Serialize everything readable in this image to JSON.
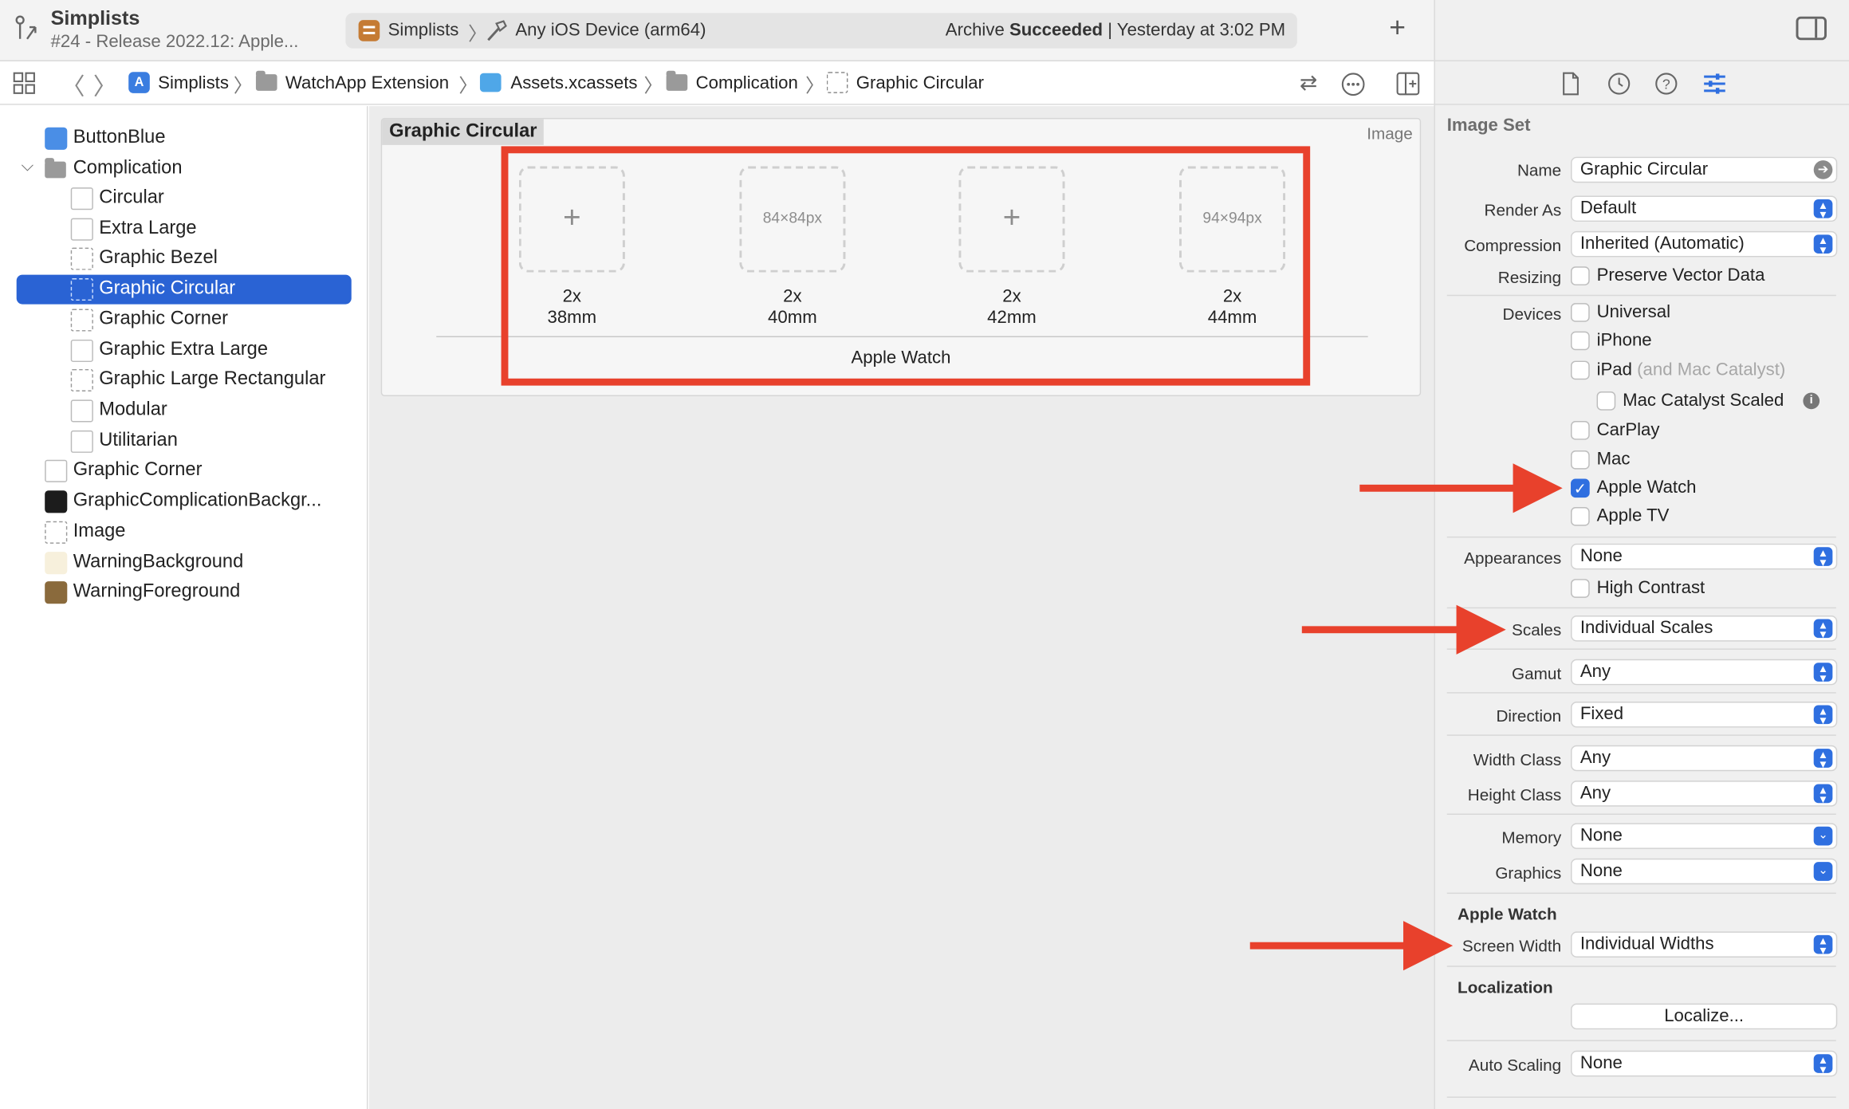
{
  "toolbar": {
    "project_title": "Simplists",
    "project_subtitle": "#24 - Release 2022.12: Apple...",
    "scheme_name": "Simplists",
    "device": "Any iOS Device (arm64)",
    "status_prefix": "Archive ",
    "status_bold": "Succeeded",
    "status_suffix": " | Yesterday at 3:02 PM"
  },
  "breadcrumbs": [
    "Simplists",
    "WatchApp Extension",
    "Assets.xcassets",
    "Complication",
    "Graphic Circular"
  ],
  "navigator": {
    "items": [
      {
        "label": "ButtonBlue",
        "swatch": "#4a8ee6"
      },
      {
        "label": "Complication"
      },
      {
        "label": "Circular"
      },
      {
        "label": "Extra Large"
      },
      {
        "label": "Graphic Bezel"
      },
      {
        "label": "Graphic Circular"
      },
      {
        "label": "Graphic Corner"
      },
      {
        "label": "Graphic Extra Large"
      },
      {
        "label": "Graphic Large Rectangular"
      },
      {
        "label": "Modular"
      },
      {
        "label": "Utilitarian"
      },
      {
        "label": "Graphic Corner"
      },
      {
        "label": "GraphicComplicationBackgr...",
        "swatch": "#1c1c1c"
      },
      {
        "label": "Image"
      },
      {
        "label": "WarningBackground",
        "swatch": "#f7f0dc"
      },
      {
        "label": "WarningForeground",
        "swatch": "#8a6a3c"
      }
    ]
  },
  "editor": {
    "set_title": "Graphic Circular",
    "set_type": "Image",
    "slots": [
      {
        "scale": "2x",
        "size": "38mm",
        "placeholder": "+"
      },
      {
        "scale": "2x",
        "size": "40mm",
        "placeholder": "84×84px"
      },
      {
        "scale": "2x",
        "size": "42mm",
        "placeholder": "+"
      },
      {
        "scale": "2x",
        "size": "44mm",
        "placeholder": "94×94px"
      }
    ],
    "footer": "Apple Watch"
  },
  "inspector": {
    "section_title": "Image Set",
    "name_label": "Name",
    "name_value": "Graphic Circular",
    "render_as_label": "Render As",
    "render_as_value": "Default",
    "compression_label": "Compression",
    "compression_value": "Inherited (Automatic)",
    "resizing_label": "Resizing",
    "resizing_option": "Preserve Vector Data",
    "devices_label": "Devices",
    "devices": [
      "Universal",
      "iPhone",
      "iPad",
      "Mac Catalyst Scaled",
      "CarPlay",
      "Mac",
      "Apple Watch",
      "Apple TV"
    ],
    "ipad_note": "(and Mac Catalyst)",
    "appearances_label": "Appearances",
    "appearances_value": "None",
    "high_contrast": "High Contrast",
    "scales_label": "Scales",
    "scales_value": "Individual Scales",
    "gamut_label": "Gamut",
    "gamut_value": "Any",
    "direction_label": "Direction",
    "direction_value": "Fixed",
    "width_class_label": "Width Class",
    "width_class_value": "Any",
    "height_class_label": "Height Class",
    "height_class_value": "Any",
    "memory_label": "Memory",
    "memory_value": "None",
    "graphics_label": "Graphics",
    "graphics_value": "None",
    "watch_section": "Apple Watch",
    "screen_width_label": "Screen Width",
    "screen_width_value": "Individual Widths",
    "localization_section": "Localization",
    "localize_button": "Localize...",
    "auto_scaling_label": "Auto Scaling",
    "auto_scaling_value": "None"
  },
  "colors": {
    "selection": "#2a63d4",
    "annotation": "#e8412c",
    "checkbox_accent": "#2f6fe0"
  }
}
